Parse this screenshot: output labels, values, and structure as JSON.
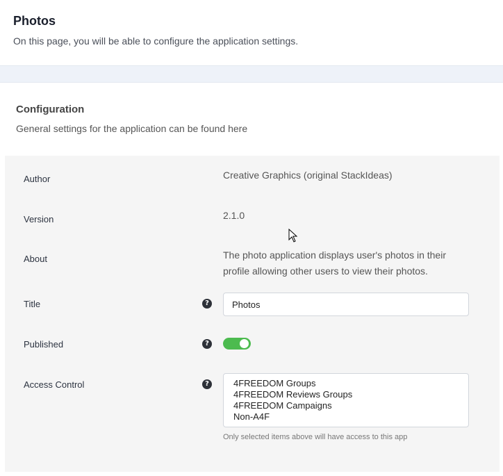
{
  "page": {
    "title": "Photos",
    "description": "On this page, you will be able to configure the application settings."
  },
  "panel": {
    "title": "Configuration",
    "description": "General settings for the application can be found here"
  },
  "fields": {
    "author": {
      "label": "Author",
      "value": "Creative Graphics (original StackIdeas)"
    },
    "version": {
      "label": "Version",
      "value": "2.1.0"
    },
    "about": {
      "label": "About",
      "value_line1": "The photo application displays user's photos in their",
      "value_line2": "profile allowing other users to view their photos."
    },
    "title": {
      "label": "Title",
      "value": "Photos",
      "help_icon": "question-circle-icon"
    },
    "published": {
      "label": "Published",
      "enabled": true,
      "help_icon": "question-circle-icon",
      "color": "#4cbb4f"
    },
    "access": {
      "label": "Access Control",
      "help_icon": "question-circle-icon",
      "options": [
        "4FREEDOM Groups",
        "4FREEDOM Reviews Groups",
        "4FREEDOM Campaigns",
        "Non-A4F"
      ],
      "hint": "Only selected items above will have access to this app"
    }
  },
  "help_glyph": "?"
}
